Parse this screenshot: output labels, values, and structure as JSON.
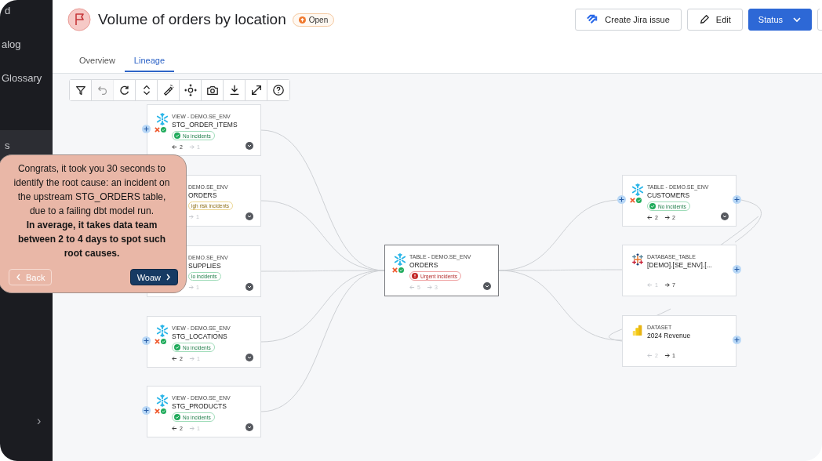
{
  "sidebar": {
    "groups": [
      {
        "items": [
          {
            "label": "d",
            "selected": false
          },
          {
            "label": "alog",
            "selected": false
          },
          {
            "label": "Glossary",
            "selected": false
          }
        ]
      },
      {
        "items": [
          {
            "label": "s",
            "selected": true
          }
        ]
      }
    ],
    "collapse": "›"
  },
  "header": {
    "title": "Volume of orders by location",
    "status": "Open",
    "buttons": [
      {
        "kind": "jira",
        "label": "Create Jira issue"
      },
      {
        "kind": "edit",
        "label": "Edit"
      },
      {
        "kind": "primary",
        "label": "Status"
      },
      {
        "kind": "overflow"
      }
    ]
  },
  "tabs": [
    {
      "label": "Overview",
      "selected": false
    },
    {
      "label": "Lineage",
      "selected": true
    }
  ],
  "toolbar": [
    {
      "kind": "filter",
      "disabled": false
    },
    {
      "kind": "undo",
      "disabled": true
    },
    {
      "kind": "refresh",
      "disabled": false
    },
    {
      "kind": "chevrons",
      "disabled": false
    },
    {
      "kind": "flashlight",
      "disabled": false
    },
    {
      "kind": "move",
      "disabled": false
    },
    {
      "kind": "camera",
      "disabled": false
    },
    {
      "kind": "download",
      "disabled": false
    },
    {
      "kind": "resize",
      "disabled": false
    },
    {
      "kind": "help",
      "disabled": false
    }
  ],
  "nodes": [
    {
      "kind": "snowflake",
      "type_label": "VIEW - DEMO.SE_ENV",
      "name": "STG_ORDER_ITEMS",
      "badge": {
        "kind": "ok",
        "text": "No incidents"
      },
      "counts": [
        {
          "kind": "upstream",
          "value": "2",
          "active": true
        },
        {
          "kind": "downstream",
          "value": "1",
          "active": false
        }
      ],
      "selected": false,
      "add_left": true,
      "add_right": false
    },
    {
      "kind": "covered",
      "type_label": "DEMO.SE_ENV",
      "name": "ORDERS",
      "badge": {
        "kind": "high",
        "text": "igh risk incidents"
      },
      "counts": [
        {
          "kind": "downstream",
          "value": "1",
          "active": false
        }
      ],
      "selected": false,
      "add_right": false
    },
    {
      "kind": "covered",
      "type_label": "DEMO.SE_ENV",
      "name": "SUPPLIES",
      "badge": {
        "kind": "ok",
        "text": "lo incidents"
      },
      "counts": [
        {
          "kind": "downstream",
          "value": "1",
          "active": false
        }
      ],
      "selected": false,
      "add_right": false
    },
    {
      "kind": "snowflake",
      "type_label": "VIEW - DEMO.SE_ENV",
      "name": "STG_LOCATIONS",
      "badge": {
        "kind": "ok",
        "text": "No incidents"
      },
      "counts": [
        {
          "kind": "upstream",
          "value": "2",
          "active": true
        },
        {
          "kind": "downstream",
          "value": "1",
          "active": false
        }
      ],
      "selected": false,
      "add_left": true,
      "add_right": false
    },
    {
      "kind": "snowflake",
      "type_label": "VIEW - DEMO.SE_ENV",
      "name": "STG_PRODUCTS",
      "badge": {
        "kind": "ok",
        "text": "No incidents"
      },
      "counts": [
        {
          "kind": "upstream",
          "value": "2",
          "active": true
        },
        {
          "kind": "downstream",
          "value": "1",
          "active": false
        }
      ],
      "selected": false,
      "add_left": true,
      "add_right": false
    },
    {
      "kind": "snowflake",
      "type_label": "TABLE - DEMO.SE_ENV",
      "name": "ORDERS",
      "badge": {
        "kind": "urgent",
        "text": "Urgent incidents"
      },
      "counts": [
        {
          "kind": "upstream",
          "value": "5",
          "active": false
        },
        {
          "kind": "downstream",
          "value": "3",
          "active": false
        }
      ],
      "selected": true,
      "add_left": false,
      "add_right": false
    },
    {
      "kind": "snowflake",
      "type_label": "TABLE - DEMO.SE_ENV",
      "name": "CUSTOMERS",
      "badge": {
        "kind": "ok",
        "text": "No incidents"
      },
      "counts": [
        {
          "kind": "upstream",
          "value": "2",
          "active": true
        },
        {
          "kind": "downstream",
          "value": "2",
          "active": true
        }
      ],
      "selected": false,
      "add_left": true,
      "add_right": true
    },
    {
      "kind": "tableau",
      "type_label": "DATABASE_TABLE",
      "name": "[DEMO].[SE_ENV].[...",
      "counts": [
        {
          "kind": "upstream",
          "value": "1",
          "active": false
        },
        {
          "kind": "downstream",
          "value": "7",
          "active": true
        }
      ],
      "selected": false,
      "add_left": false,
      "add_right": true
    },
    {
      "kind": "powerbi",
      "type_label": "DATASET",
      "name": "2024 Revenue",
      "counts": [
        {
          "kind": "upstream",
          "value": "2",
          "active": false
        },
        {
          "kind": "downstream",
          "value": "1",
          "active": true
        }
      ],
      "selected": false,
      "add_left": false,
      "add_right": true
    }
  ],
  "tour": {
    "text": "Congrats, it took you 30 seconds to identify the root cause: an incident on the upstream STG_ORDERS table, due to a failing dbt model run.\n**In average, it takes data team between 2 to 4 days to spot such root causes.**",
    "back": "Back",
    "next": "Woaw"
  }
}
